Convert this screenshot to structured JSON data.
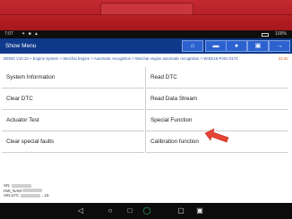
{
  "status_bar": {
    "time": "7:07",
    "icons": "✦ ■ ▲",
    "battery_text": "100%"
  },
  "header": {
    "title": "Show Menu",
    "toolbar": [
      {
        "name": "home-button",
        "icon": "home-icon",
        "glyph": "⌂"
      },
      {
        "name": "vehicle-button",
        "icon": "car-icon",
        "glyph": "▬"
      },
      {
        "name": "message-button",
        "icon": "chat-icon",
        "glyph": "●"
      },
      {
        "name": "print-button",
        "icon": "printer-icon",
        "glyph": "▣"
      },
      {
        "name": "exit-button",
        "icon": "exit-icon",
        "glyph": "→"
      }
    ]
  },
  "breadcrumb": {
    "path": "DEMO V10.10 > Engine System > Weichai Engine > Automatic recognition > Weichai engine automatic recognition > WISE15-P201-0174",
    "corner": "23.3V"
  },
  "menu": {
    "left": [
      "System Information",
      "Clear DTC",
      "Actuator Test",
      "Clear special faults"
    ],
    "right": [
      "Read DTC",
      "Read Data Stream",
      "Special Function",
      "Calibration function"
    ]
  },
  "vehicle_info": [
    {
      "label": "SN:",
      "value": "981..."
    },
    {
      "label": "HW_NAM",
      "value": ""
    },
    {
      "label": "VIN:LFC",
      "value": "...15"
    }
  ],
  "colors": {
    "device_red": "#b51e25",
    "header_blue": "#0f3a8b",
    "button_blue": "#2c62cf",
    "arrow_red": "#e64434",
    "nav_green": "#27c36a"
  },
  "nav": {
    "icons": [
      "back-icon",
      "home-icon",
      "recent-apps-icon",
      "vci-icon",
      "screenshot-icon",
      "gallery-icon"
    ]
  }
}
